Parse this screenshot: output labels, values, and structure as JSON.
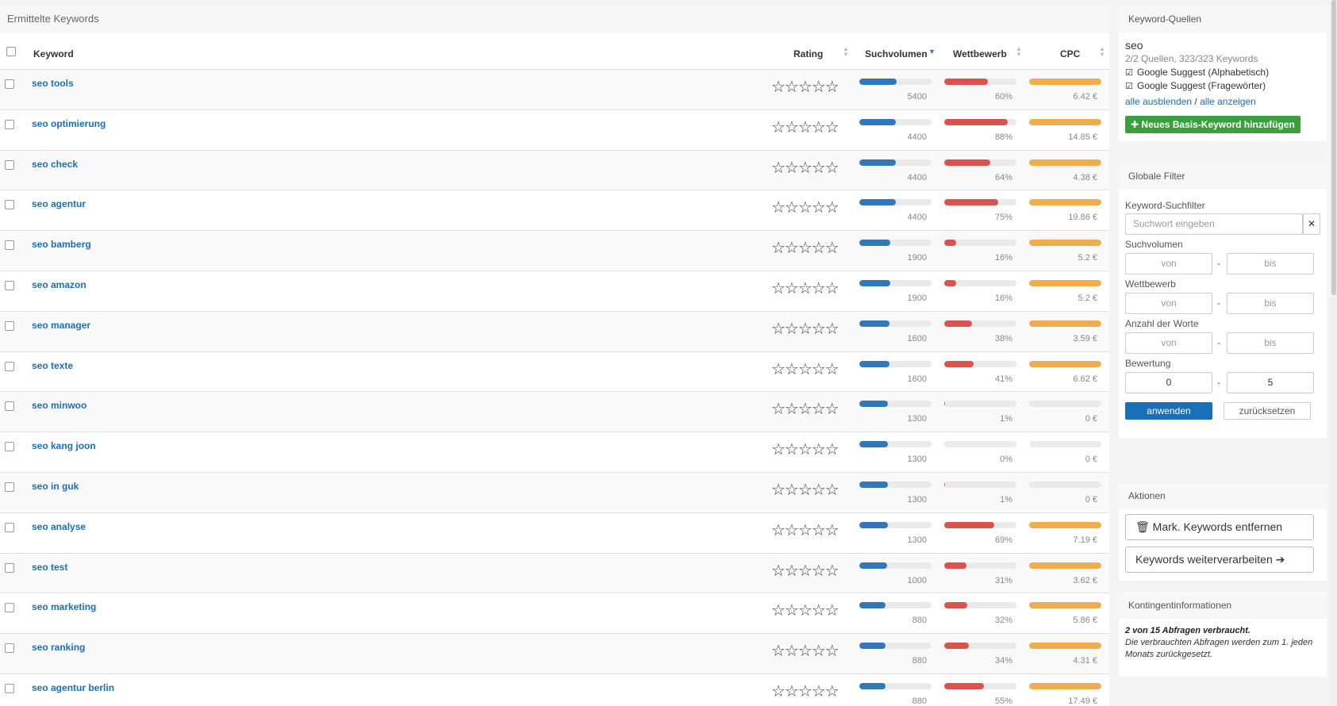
{
  "main": {
    "title": "Ermittelte Keywords",
    "columns": {
      "keyword": "Keyword",
      "rating": "Rating",
      "volume": "Suchvolumen",
      "competition": "Wettbewerb",
      "cpc": "CPC"
    },
    "rows": [
      {
        "keyword": "seo tools",
        "volume": "5400",
        "volume_frac": 0.52,
        "competition": "60%",
        "competition_frac": 0.6,
        "cpc": "6.42 €"
      },
      {
        "keyword": "seo optimierung",
        "volume": "4400",
        "volume_frac": 0.5,
        "competition": "88%",
        "competition_frac": 0.88,
        "cpc": "14.85 €"
      },
      {
        "keyword": "seo check",
        "volume": "4400",
        "volume_frac": 0.5,
        "competition": "64%",
        "competition_frac": 0.64,
        "cpc": "4.38 €"
      },
      {
        "keyword": "seo agentur",
        "volume": "4400",
        "volume_frac": 0.5,
        "competition": "75%",
        "competition_frac": 0.75,
        "cpc": "19.86 €"
      },
      {
        "keyword": "seo bamberg",
        "volume": "1900",
        "volume_frac": 0.43,
        "competition": "16%",
        "competition_frac": 0.16,
        "cpc": "5.2 €"
      },
      {
        "keyword": "seo amazon",
        "volume": "1900",
        "volume_frac": 0.43,
        "competition": "16%",
        "competition_frac": 0.16,
        "cpc": "5.2 €"
      },
      {
        "keyword": "seo manager",
        "volume": "1600",
        "volume_frac": 0.42,
        "competition": "38%",
        "competition_frac": 0.38,
        "cpc": "3.59 €"
      },
      {
        "keyword": "seo texte",
        "volume": "1600",
        "volume_frac": 0.42,
        "competition": "41%",
        "competition_frac": 0.41,
        "cpc": "6.62 €"
      },
      {
        "keyword": "seo minwoo",
        "volume": "1300",
        "volume_frac": 0.4,
        "competition": "1%",
        "competition_frac": 0.01,
        "cpc": "0 €"
      },
      {
        "keyword": "seo kang joon",
        "volume": "1300",
        "volume_frac": 0.4,
        "competition": "0%",
        "competition_frac": 0.0,
        "cpc": "0 €"
      },
      {
        "keyword": "seo in guk",
        "volume": "1300",
        "volume_frac": 0.4,
        "competition": "1%",
        "competition_frac": 0.01,
        "cpc": "0 €"
      },
      {
        "keyword": "seo analyse",
        "volume": "1300",
        "volume_frac": 0.4,
        "competition": "69%",
        "competition_frac": 0.69,
        "cpc": "7.19 €"
      },
      {
        "keyword": "seo test",
        "volume": "1000",
        "volume_frac": 0.38,
        "competition": "31%",
        "competition_frac": 0.31,
        "cpc": "3.62 €"
      },
      {
        "keyword": "seo marketing",
        "volume": "880",
        "volume_frac": 0.36,
        "competition": "32%",
        "competition_frac": 0.32,
        "cpc": "5.86 €"
      },
      {
        "keyword": "seo ranking",
        "volume": "880",
        "volume_frac": 0.36,
        "competition": "34%",
        "competition_frac": 0.34,
        "cpc": "4.31 €"
      },
      {
        "keyword": "seo agentur berlin",
        "volume": "880",
        "volume_frac": 0.36,
        "competition": "55%",
        "competition_frac": 0.55,
        "cpc": "17.49 €"
      }
    ]
  },
  "sources": {
    "title": "Keyword-Quellen",
    "keyword": "seo",
    "info": "2/2 Quellen, 323/323 Keywords",
    "items": [
      "Google Suggest (Alphabetisch)",
      "Google Suggest (Fragewörter)"
    ],
    "hide_all": "alle ausblenden",
    "sep": "/",
    "show_all": "alle anzeigen",
    "add_button": "Neues Basis-Keyword hinzufügen"
  },
  "filter": {
    "title": "Globale Filter",
    "search_label": "Keyword-Suchfilter",
    "search_placeholder": "Suchwort eingeben",
    "volume_label": "Suchvolumen",
    "competition_label": "Wettbewerb",
    "words_label": "Anzahl der Worte",
    "rating_label": "Bewertung",
    "from_placeholder": "von",
    "to_placeholder": "bis",
    "rating_from": "0",
    "rating_to": "5",
    "apply": "anwenden",
    "reset": "zurücksetzen"
  },
  "actions": {
    "title": "Aktionen",
    "remove": "Mark. Keywords entfernen",
    "process": "Keywords weiterverarbeiten"
  },
  "quota": {
    "title": "Kontingentinformationen",
    "used": "2 von 15 Abfragen verbraucht.",
    "note": "Die verbrauchten Abfragen werden zum 1. jeden Monats zurückgesetzt."
  },
  "colors": {
    "volume": "#3278b9",
    "competition": "#d9534f",
    "cpc": "#f0ad4e",
    "link": "#1a6fb8",
    "add_button": "#3ba03b"
  }
}
